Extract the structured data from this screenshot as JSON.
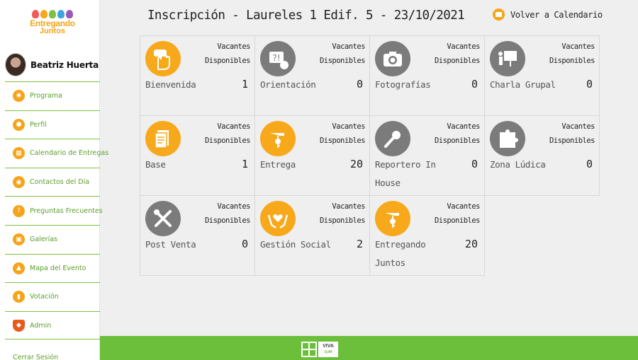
{
  "brand": {
    "logo_line1": "Entregando",
    "logo_line2": "Juntos"
  },
  "user": {
    "name": "Beatriz Huerta"
  },
  "sidebar": {
    "items": [
      {
        "label": "Programa",
        "icon": "compass-icon"
      },
      {
        "label": "Perfil",
        "icon": "person-icon"
      },
      {
        "label": "Calendario de Entregas",
        "icon": "calendar-icon"
      },
      {
        "label": "Contactos del Día",
        "icon": "chat-icon"
      },
      {
        "label": "Preguntas Frecuentes",
        "icon": "question-icon"
      },
      {
        "label": "Galerías",
        "icon": "image-icon"
      },
      {
        "label": "Mapa del Evento",
        "icon": "map-icon"
      },
      {
        "label": "Votación",
        "icon": "vote-icon"
      },
      {
        "label": "Admin",
        "icon": "shield-icon"
      }
    ],
    "logout": "Cerrar Sesión"
  },
  "header": {
    "title": "Inscripción - Laureles 1 Edif. 5 - 23/10/2021",
    "back_label": "Volver a Calendario"
  },
  "cards": [
    {
      "name": "Bienvenida",
      "vac1": "Vacantes",
      "vac2": "Disponibles",
      "count": "1",
      "icon": "hand-wave-icon",
      "color": "orange"
    },
    {
      "name": "Orientación",
      "vac1": "Vacantes",
      "vac2": "Disponibles",
      "count": "0",
      "icon": "question-bubble-icon",
      "color": "gray"
    },
    {
      "name": "Fotografías",
      "vac1": "Vacantes",
      "vac2": "Disponibles",
      "count": "0",
      "icon": "camera-icon",
      "color": "gray"
    },
    {
      "name": "Charla Grupal",
      "vac1": "Vacantes",
      "vac2": "Disponibles",
      "count": "0",
      "icon": "presentation-icon",
      "color": "gray"
    },
    {
      "name": "Base",
      "vac1": "Vacantes",
      "vac2": "Disponibles",
      "count": "1",
      "icon": "documents-icon",
      "color": "orange"
    },
    {
      "name": "Entrega",
      "vac1": "Vacantes",
      "vac2": "Disponibles",
      "count": "20",
      "icon": "key-handover-icon",
      "color": "orange"
    },
    {
      "name": "Reportero In House",
      "vac1": "Vacantes",
      "vac2": "Disponibles",
      "count": "0",
      "icon": "microphone-icon",
      "color": "gray"
    },
    {
      "name": "Zona Lúdica",
      "vac1": "Vacantes",
      "vac2": "Disponibles",
      "count": "0",
      "icon": "puzzle-icon",
      "color": "gray"
    },
    {
      "name": "Post Venta",
      "vac1": "Vacantes",
      "vac2": "Disponibles",
      "count": "0",
      "icon": "tools-icon",
      "color": "gray"
    },
    {
      "name": "Gestión Social",
      "vac1": "Vacantes",
      "vac2": "Disponibles",
      "count": "2",
      "icon": "heart-hands-icon",
      "color": "orange"
    },
    {
      "name": "Entregando Juntos",
      "vac1": "Vacantes",
      "vac2": "Disponibles",
      "count": "20",
      "icon": "key-handover-icon",
      "color": "orange"
    }
  ],
  "footer": {
    "logo_text1": "VIVA",
    "logo_text2": "GyM"
  },
  "colors": {
    "accent_orange": "#f7a81b",
    "accent_green": "#6bbf3b",
    "icon_gray": "#7b7b7b"
  }
}
